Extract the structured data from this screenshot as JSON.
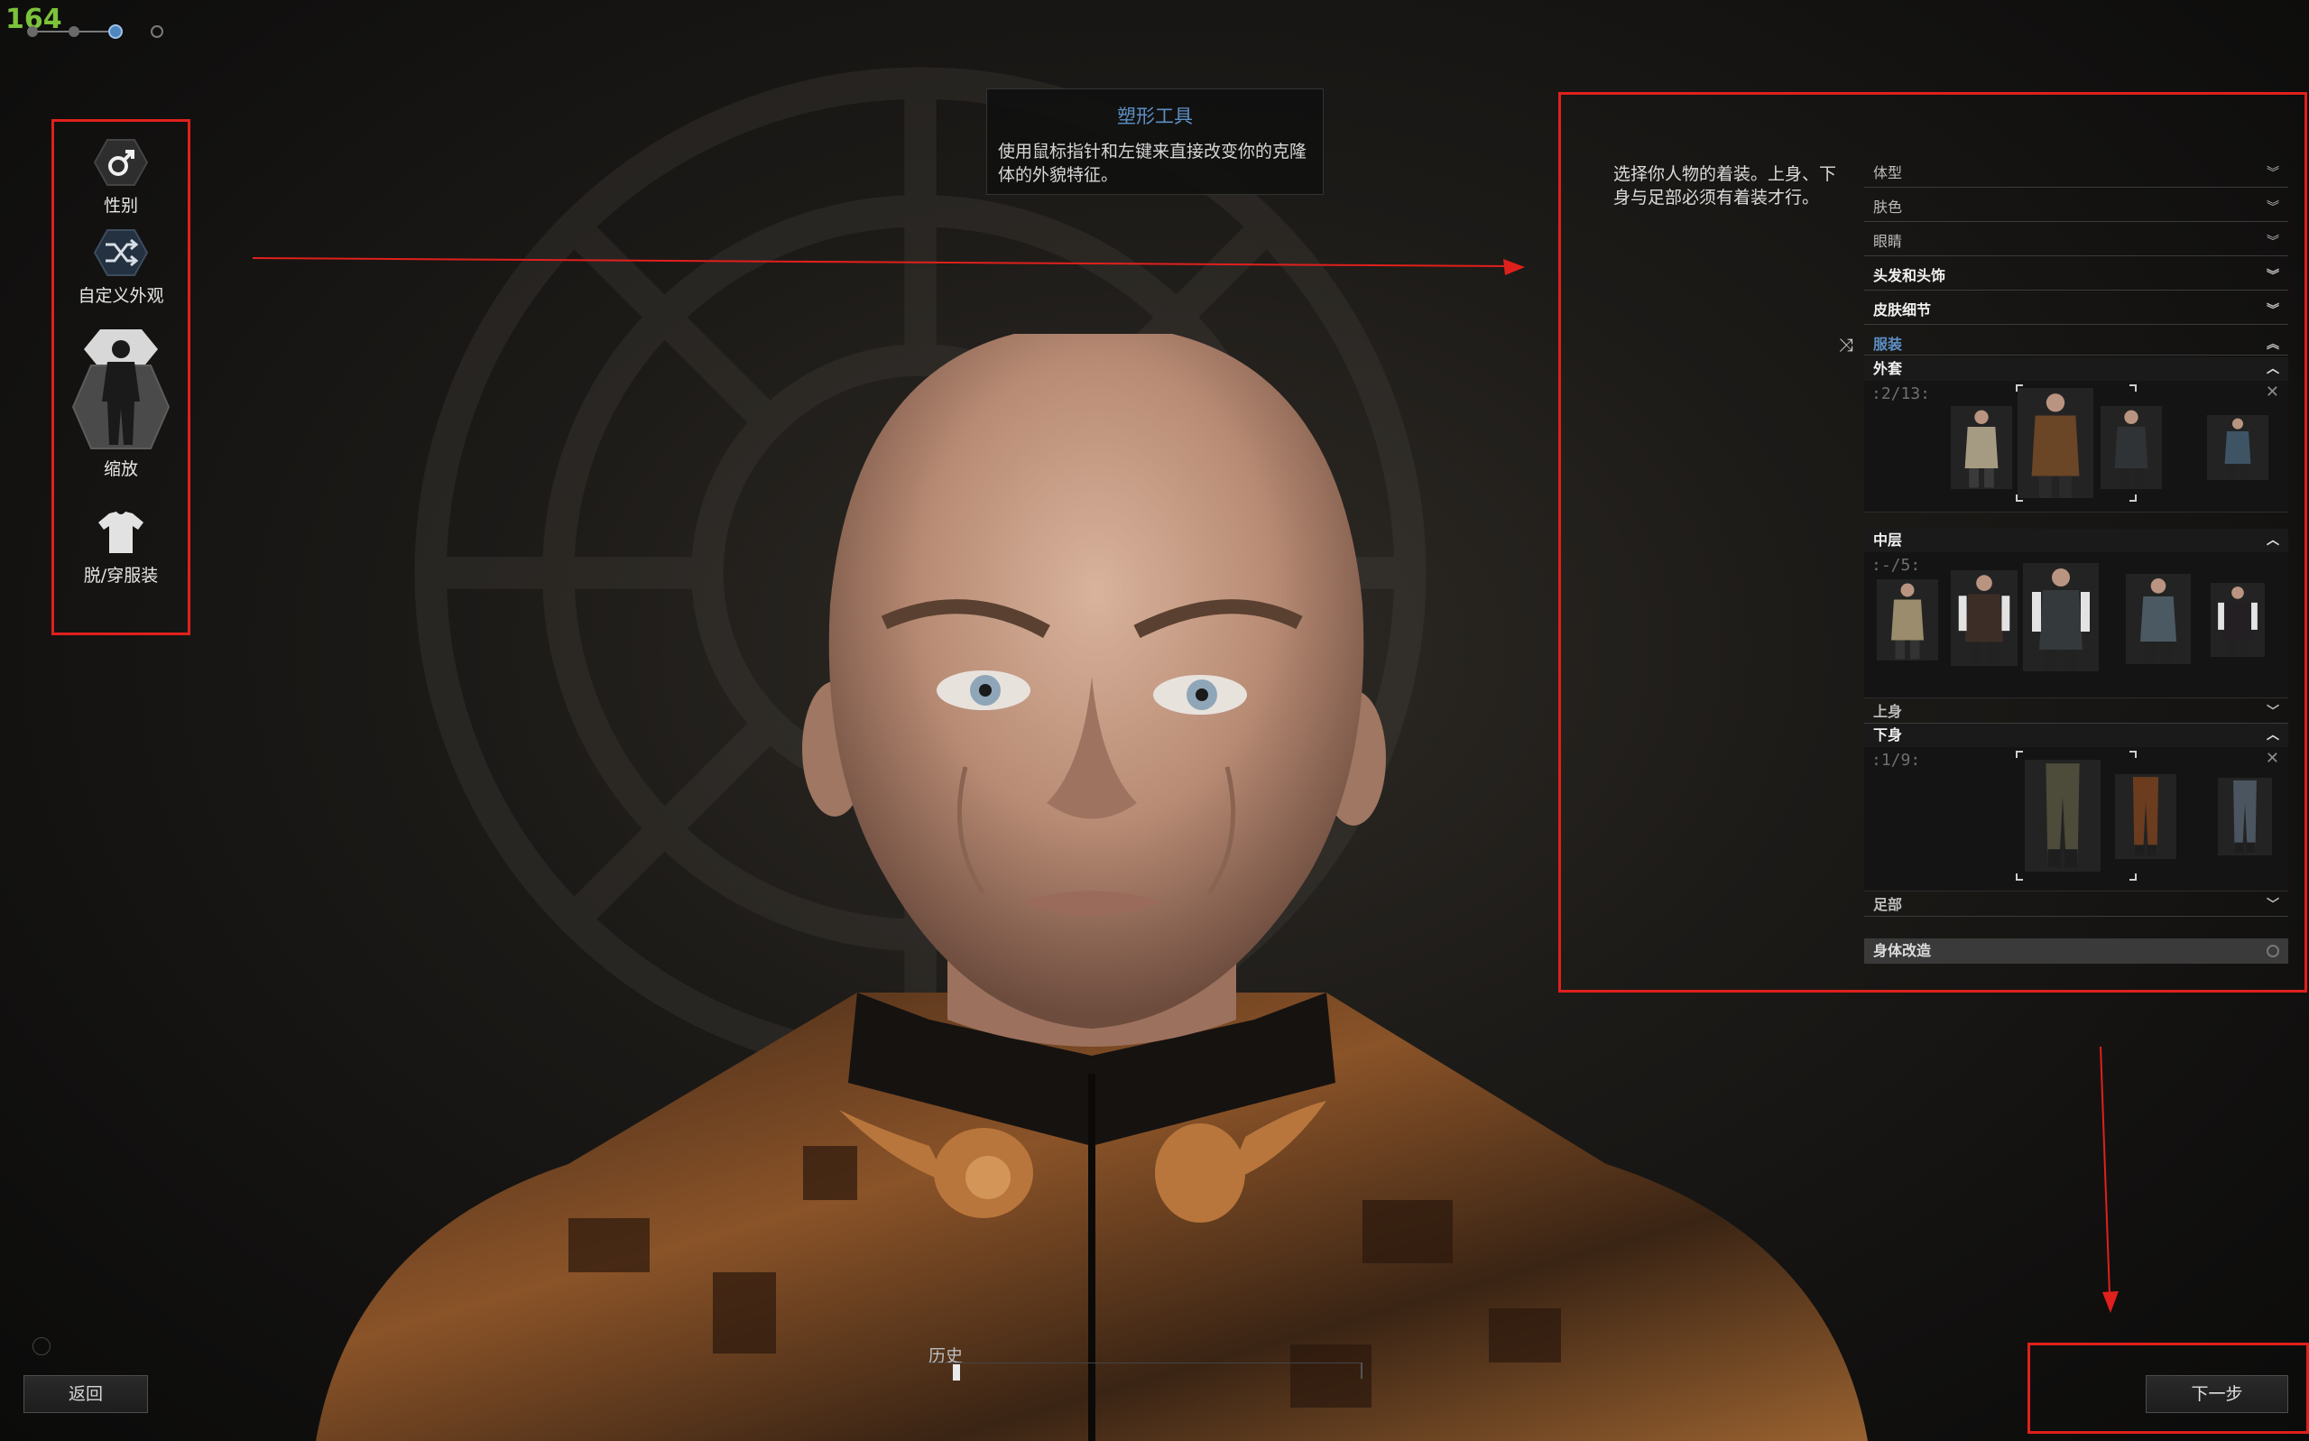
{
  "fps_counter": "164",
  "steps": {
    "count": 4,
    "current": 3
  },
  "left_tools": [
    {
      "label": "性别",
      "icon": "male-gender-icon"
    },
    {
      "label": "自定义外观",
      "icon": "shuffle-icon"
    },
    {
      "label": "缩放",
      "icon": "body-silhouette-icon"
    },
    {
      "label": "脱/穿服装",
      "icon": "shirt-icon"
    }
  ],
  "tooltip": {
    "title": "塑形工具",
    "body": "使用鼠标指针和左键来直接改变你的克隆体的外貌特征。"
  },
  "right_panel": {
    "instructions": "选择你人物的着装。上身、下身与足部必须有着装才行。",
    "sections": [
      {
        "label": "体型",
        "bold": false
      },
      {
        "label": "肤色",
        "bold": false
      },
      {
        "label": "眼睛",
        "bold": false
      },
      {
        "label": "头发和头饰",
        "bold": true
      },
      {
        "label": "皮肤细节",
        "bold": true
      },
      {
        "label": "服装",
        "active": true
      }
    ],
    "clothing": {
      "outer": {
        "label": "外套",
        "count": ":2/13:"
      },
      "middle": {
        "label": "中层",
        "count": ":-/5:"
      },
      "upper": {
        "label": "上身"
      },
      "lower": {
        "label": "下身",
        "count": ":1/9:"
      },
      "feet": {
        "label": "足部"
      }
    },
    "body_mod": "身体改造"
  },
  "bottom": {
    "back_label": "返回",
    "history_label": "历史",
    "next_label": "下一步"
  },
  "colors": {
    "highlight_box": "#e0201c",
    "accent_blue": "#5d8fc4",
    "fps_green": "#7cc23a"
  }
}
